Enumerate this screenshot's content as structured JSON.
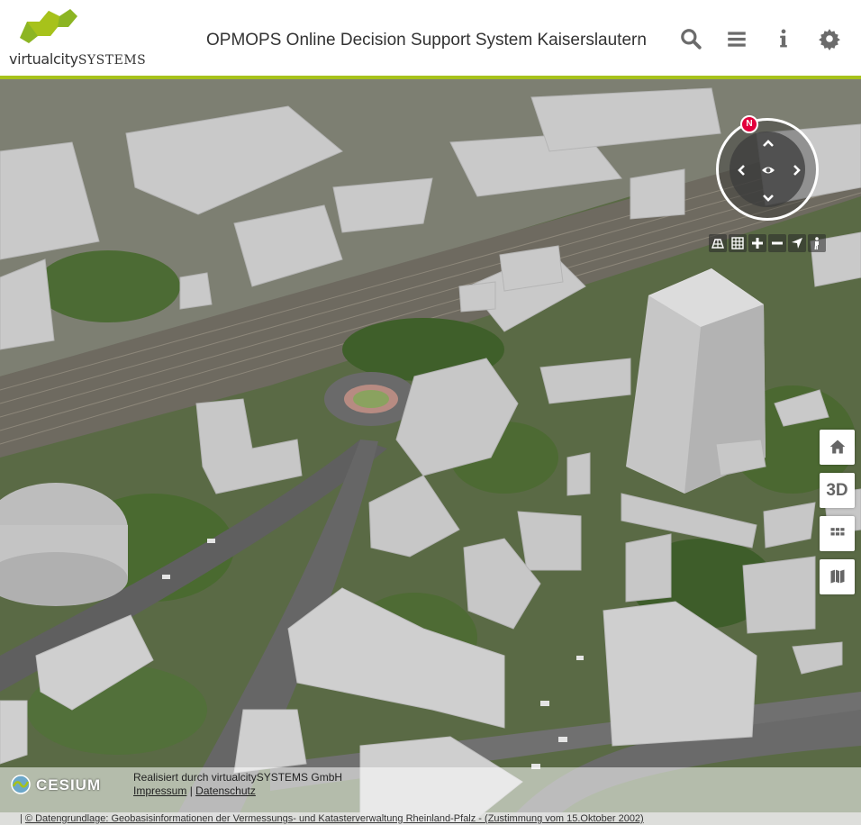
{
  "header": {
    "logo_text_1": "virtualcity",
    "logo_text_2": "SYSTEMS",
    "title": "OPMOPS Online Decision Support System Kaiserslautern",
    "icons": [
      "search-icon",
      "menu-icon",
      "info-icon",
      "gear-icon"
    ]
  },
  "navigation": {
    "north_label": "N",
    "tools": [
      "tilt-icon",
      "grid-icon",
      "zoom-in-icon",
      "zoom-out-icon",
      "locate-icon",
      "pedestrian-icon"
    ]
  },
  "side_buttons": {
    "home": "home-icon",
    "view_3d_label": "3D",
    "layers": "apps-icon",
    "map": "map-icon"
  },
  "credits": {
    "cesium_label": "CESIUM",
    "made_by": "Realisiert durch virtualcitySYSTEMS GmbH",
    "impressum": "Impressum",
    "separator": "|",
    "datenschutz": "Datenschutz",
    "attribution_prefix": "|",
    "attribution": "© Datengrundlage: Geobasisinformationen der Vermessungs- und Katasterverwaltung Rheinland-Pfalz - (Zustimmung vom 15.Oktober 2002)"
  },
  "colors": {
    "accent": "#a7c21b",
    "icon_gray": "#6b6b6b",
    "north_red": "#e2003c"
  }
}
